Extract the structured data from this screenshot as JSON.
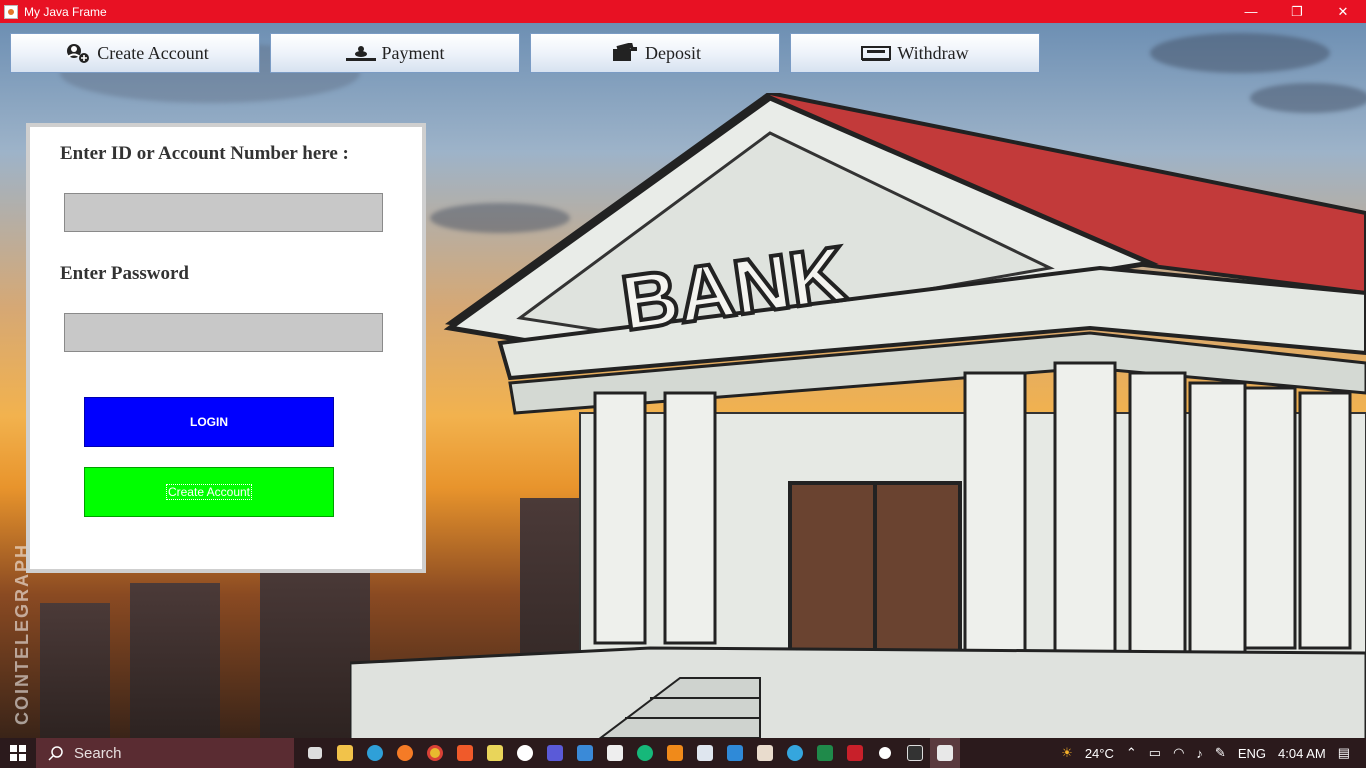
{
  "window": {
    "title": "My Java Frame",
    "minimize": "—",
    "maximize": "❐",
    "close": "✕"
  },
  "nav": {
    "create_account": "Create Account",
    "payment": "Payment",
    "deposit": "Deposit",
    "withdraw": "Withdraw"
  },
  "login": {
    "id_label": "Enter ID or Account Number here :",
    "password_label": "Enter Password",
    "id_value": "",
    "password_value": "",
    "login_button": "LOGIN",
    "create_button": "Create Account"
  },
  "background": {
    "sign": "BANK",
    "watermark": "COINTELEGRAPH"
  },
  "taskbar": {
    "search_placeholder": "Search",
    "weather": "24°C",
    "language": "ENG",
    "time": "4:04 AM"
  },
  "colors": {
    "titlebar": "#e81123",
    "login_button": "#0000ff",
    "create_button": "#00ff00",
    "field": "#c8c8c8"
  }
}
